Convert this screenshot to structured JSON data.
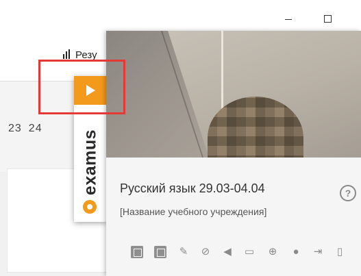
{
  "window": {
    "minimize_glyph": "—",
    "maximize_glyph": "☐"
  },
  "background": {
    "results_label": "Резу",
    "calendar_days": [
      "23",
      "24"
    ]
  },
  "examus_tab": {
    "logo_text": "examus",
    "brand_color": "#f39a1c"
  },
  "exam_panel": {
    "subject_title": "Русский язык 29.03-04.04",
    "org_name": "[Название учебного учреждения]",
    "help_label": "?"
  },
  "toolbar": {
    "icons": [
      "excel-icon",
      "calculator-icon",
      "edit-icon",
      "eye-hidden-icon",
      "megaphone-icon",
      "chat-icon",
      "globe-icon",
      "user-icon",
      "exit-icon",
      "book-icon"
    ]
  },
  "highlight": {
    "color": "#e53935"
  }
}
